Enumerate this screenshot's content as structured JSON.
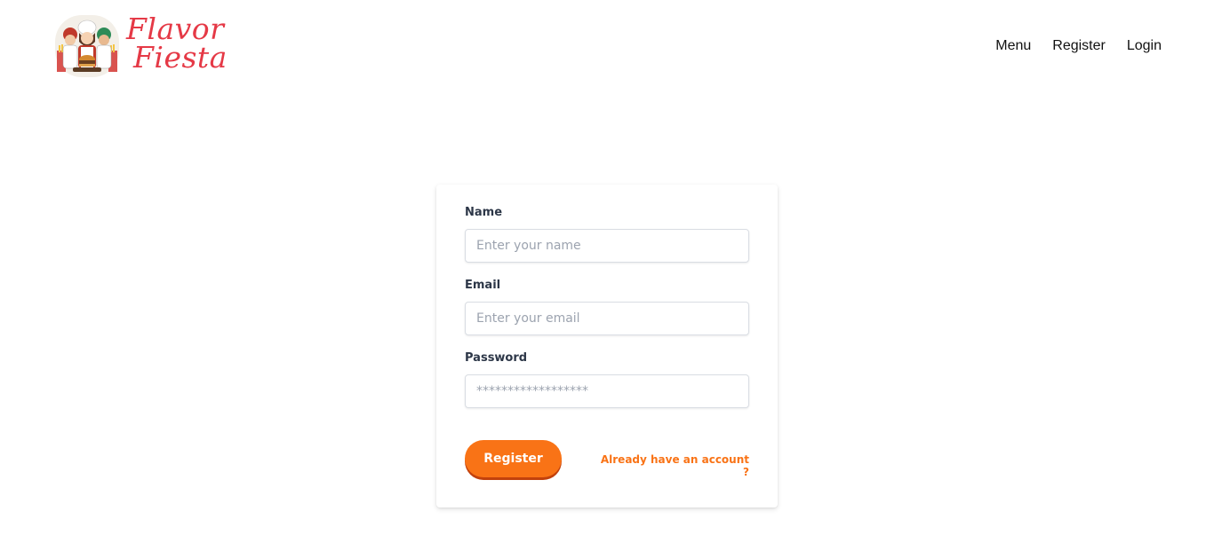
{
  "brand": {
    "line1": "Flavor",
    "line2": "Fiesta",
    "color": "#e53946"
  },
  "nav": {
    "items": [
      {
        "label": "Menu"
      },
      {
        "label": "Register"
      },
      {
        "label": "Login"
      }
    ]
  },
  "form": {
    "name": {
      "label": "Name",
      "placeholder": "Enter your name",
      "value": ""
    },
    "email": {
      "label": "Email",
      "placeholder": "Enter your email",
      "value": ""
    },
    "password": {
      "label": "Password",
      "placeholder": "******************",
      "value": ""
    },
    "submit_label": "Register",
    "login_link": "Already have an account ?"
  },
  "colors": {
    "accent": "#f97316",
    "brand": "#e53946"
  }
}
